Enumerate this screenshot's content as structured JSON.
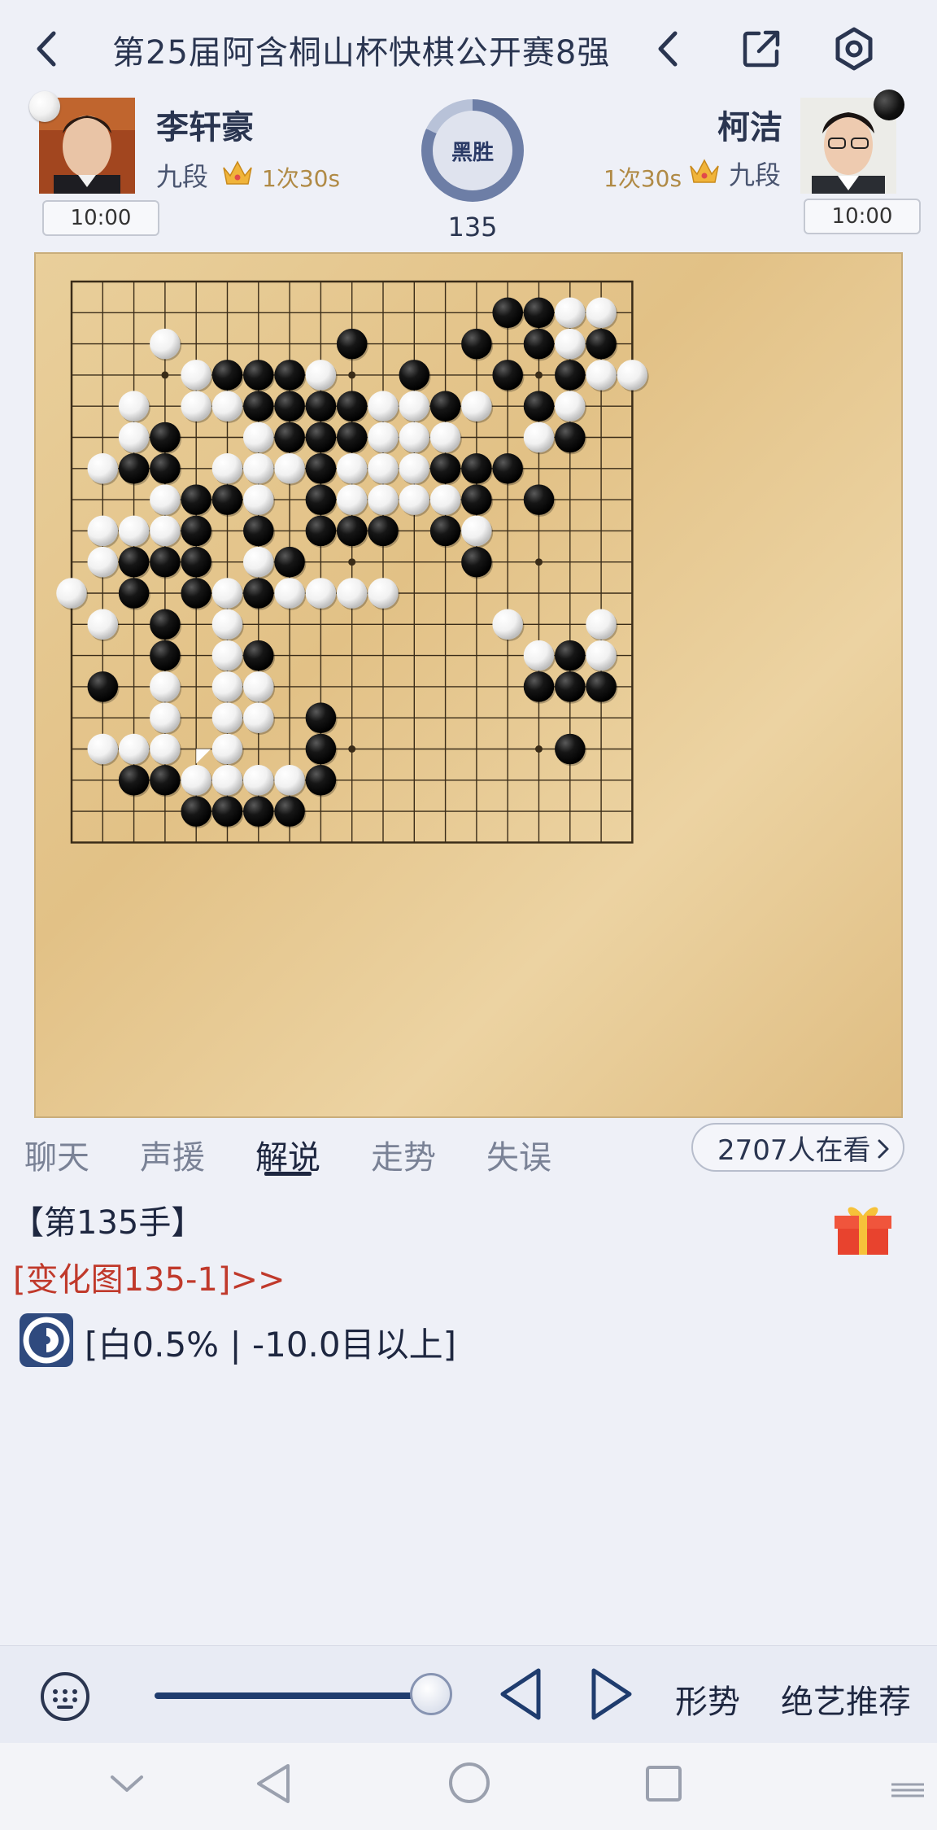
{
  "header": {
    "title": "第25届阿含桐山杯快棋公开赛8强"
  },
  "players": {
    "white": {
      "name": "李轩豪",
      "rank": "九段",
      "byoyomi": "1次30s",
      "clock": "10:00",
      "stone": "white"
    },
    "black": {
      "name": "柯洁",
      "rank": "九段",
      "byoyomi": "1次30s",
      "clock": "10:00",
      "stone": "black"
    }
  },
  "result": {
    "label": "黑胜",
    "move_number": "135",
    "white_win_share": 0.18
  },
  "board": {
    "size": 19,
    "colors": {
      "wood": "#e4c68d",
      "line": "#3a2c18"
    },
    "last_move": [
      15,
      4
    ],
    "rows": [
      "...................",
      "..............XXOO.",
      "...O.....X...X.XOX.",
      "....OXXXO..X..X.XOOO",
      "..O.OOXXXXOOXO.XO..",
      "..OX..OXXXOOO..OX..",
      ".OXX.OOOXOOOXXX....",
      "...OXXO.XOOOOX.X...",
      ".OOOX.X.XXX.XO.....",
      ".OXXX.OX.....X.....",
      "O.X.XOXOOOO........",
      ".O.X.O........O..O.",
      "...X.OX........OXO.",
      ".X.O.OO........XXX.",
      "...O.OO.X..........",
      ".OOO.O..X.......X..",
      "..XXOOOOX..........",
      "....XXXX...........",
      "..................."
    ]
  },
  "tabs": [
    "聊天",
    "声援",
    "解说",
    "走势",
    "失误"
  ],
  "active_tab": 2,
  "viewers": "2707人在看",
  "commentary": {
    "heading": "【第135手】",
    "variation_link": "[变化图135-1]>>",
    "ai_eval": "[白0.5% | -10.0目以上]"
  },
  "controls": {
    "slider_value": 1.0,
    "status_button": "形势",
    "ai_button": "绝艺推荐"
  }
}
